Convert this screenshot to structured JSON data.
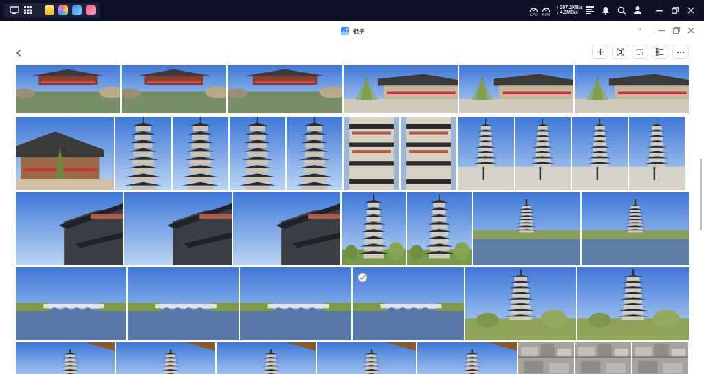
{
  "system_bar": {
    "network": {
      "upload": "↑ 207.2KB/s",
      "download": "↓ 4.3MB/s"
    },
    "gauges": [
      {
        "label": "CPU"
      },
      {
        "label": "RAM"
      }
    ],
    "icons": [
      "desktop-icon",
      "apps-grid-icon",
      "note-app-icon",
      "photos-app-icon",
      "album-app-icon",
      "video-app-icon",
      "network-monitor-icon",
      "notification-bell-icon",
      "search-icon",
      "user-icon",
      "minimize-icon",
      "restore-icon",
      "close-icon"
    ]
  },
  "window": {
    "title": "相册",
    "help_label": "?",
    "accent": "#f5a623"
  },
  "toolbar": {
    "buttons": [
      "add-icon",
      "face-scan-icon",
      "sort-icon",
      "view-list-icon",
      "more-icon"
    ]
  },
  "photos": {
    "selected_index": 3,
    "rows": [
      [
        "garden",
        "garden",
        "garden",
        "pavilion",
        "pavilion",
        "pavilion"
      ],
      [
        "pavilion-sky",
        "pagoda",
        "pagoda",
        "pagoda",
        "pagoda",
        "pagoda-close",
        "pagoda-close",
        "pagoda-person",
        "pagoda-person",
        "pagoda-person",
        "pagoda-person"
      ],
      [
        "eaves",
        "eaves",
        "eaves",
        "pagoda-trees",
        "pagoda-trees",
        "pagoda-lake",
        "pagoda-lake"
      ],
      [
        "bridge",
        "bridge",
        "bridge",
        "bridge",
        "pagoda-shore",
        "pagoda-shore"
      ],
      [
        "pagoda-far",
        "pagoda-far",
        "pagoda-far",
        "pagoda-far",
        "pagoda-far",
        "rock-wall",
        "rock-wall",
        "rock-wall"
      ]
    ]
  }
}
